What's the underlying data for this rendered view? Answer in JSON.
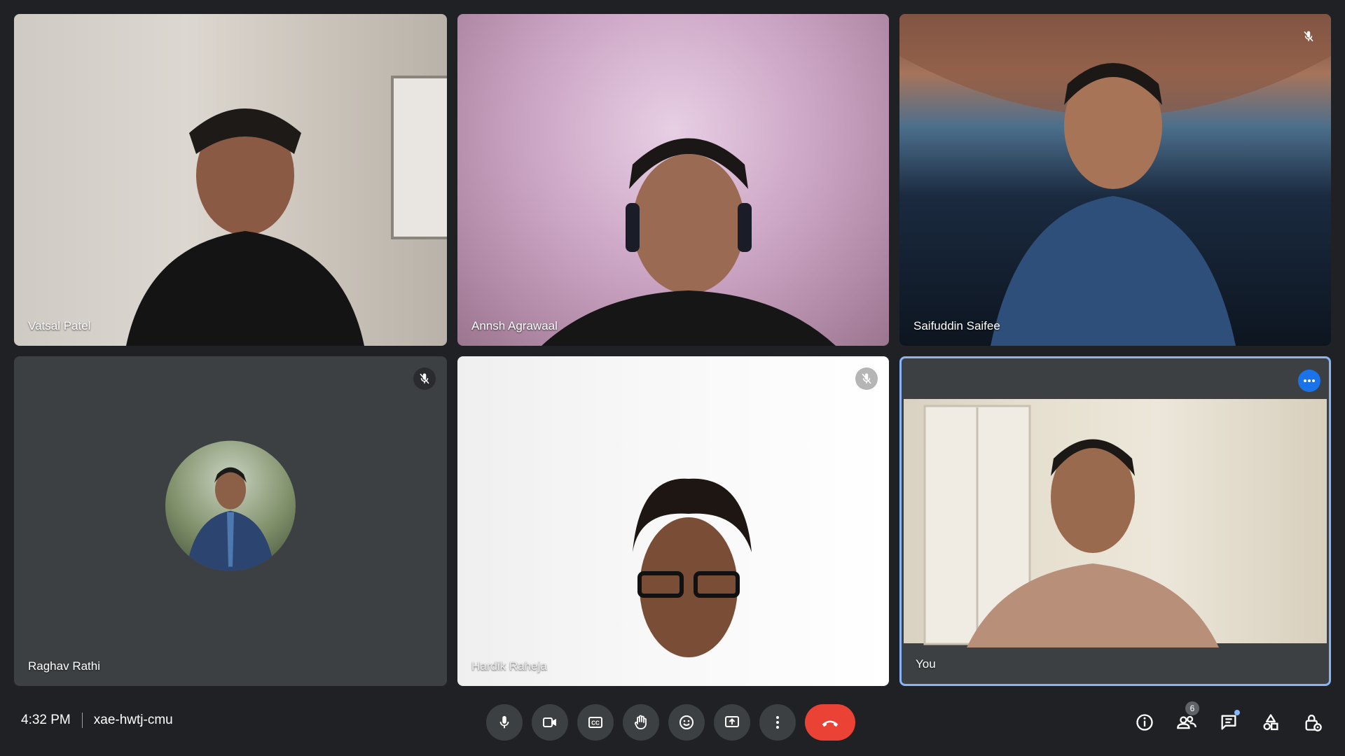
{
  "participants": [
    {
      "name": "Vatsal Patel",
      "muted": false
    },
    {
      "name": "Annsh Agrawaal",
      "muted": false
    },
    {
      "name": "Saifuddin Saifee",
      "muted": true
    },
    {
      "name": "Raghav Rathi",
      "muted": true,
      "camera_off": true
    },
    {
      "name": "Hardik Raheja",
      "muted": true
    },
    {
      "name": "You",
      "muted": false,
      "self": true
    }
  ],
  "footer": {
    "time": "4:32 PM",
    "meeting_code": "xae-hwtj-cmu"
  },
  "controls": {
    "people_count": "6"
  },
  "icons": [
    "microphone-icon",
    "camera-icon",
    "captions-icon",
    "raise-hand-icon",
    "emoji-icon",
    "present-icon",
    "more-options-icon",
    "end-call-icon",
    "info-icon",
    "people-icon",
    "chat-icon",
    "activities-icon",
    "host-controls-icon",
    "mic-off-icon",
    "more-horizontal-icon"
  ],
  "colors": {
    "accent": "#8ab4f8",
    "end_call": "#ea4335",
    "background": "#202124",
    "tile": "#3c4043"
  }
}
